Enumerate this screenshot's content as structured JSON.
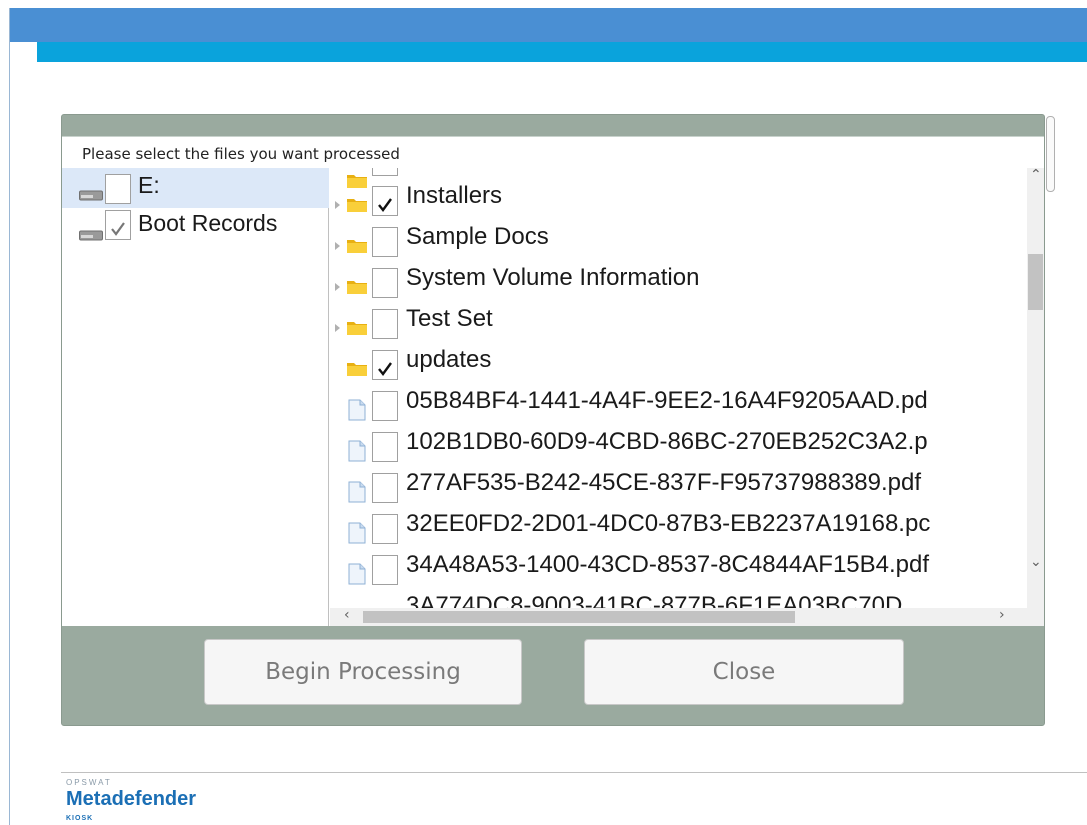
{
  "dialog": {
    "instruction": "Please select the files you want processed"
  },
  "drives": [
    {
      "label": "E:",
      "checked": false,
      "selected": true
    },
    {
      "label": "Boot Records",
      "checked": true,
      "selected": false
    }
  ],
  "files": [
    {
      "label": "Installers",
      "type": "folder",
      "expandable": true,
      "checked": true
    },
    {
      "label": "Sample Docs",
      "type": "folder",
      "expandable": true,
      "checked": false
    },
    {
      "label": "System Volume Information",
      "type": "folder",
      "expandable": true,
      "checked": false
    },
    {
      "label": "Test Set",
      "type": "folder",
      "expandable": true,
      "checked": false
    },
    {
      "label": "updates",
      "type": "folder",
      "expandable": false,
      "checked": true
    },
    {
      "label": "05B84BF4-1441-4A4F-9EE2-16A4F9205AAD.pd",
      "type": "file",
      "checked": false
    },
    {
      "label": "102B1DB0-60D9-4CBD-86BC-270EB252C3A2.p",
      "type": "file",
      "checked": false
    },
    {
      "label": "277AF535-B242-45CE-837F-F95737988389.pdf",
      "type": "file",
      "checked": false
    },
    {
      "label": "32EE0FD2-2D01-4DC0-87B3-EB2237A19168.pc",
      "type": "file",
      "checked": false
    },
    {
      "label": "34A48A53-1400-43CD-8537-8C4844AF15B4.pdf",
      "type": "file",
      "checked": false
    }
  ],
  "partial_row": "3A774DC8-9003-41BC-877B-6F1EA03BC70D",
  "buttons": {
    "begin": "Begin Processing",
    "close": "Close"
  },
  "logo": {
    "brand": "OPSWAT",
    "product": "Metadefender",
    "edition": "KIOSK"
  },
  "colors": {
    "header": "#4a8fd3",
    "subheader": "#0aa3dc",
    "dialog_bg": "#9aaa9f",
    "selection": "#dce8f8",
    "folder": "#f5c518",
    "brand": "#1b6fb5"
  },
  "icons": {
    "drive": "drive-icon",
    "folder": "folder-icon",
    "file": "file-icon",
    "check": "checkmark-icon"
  }
}
